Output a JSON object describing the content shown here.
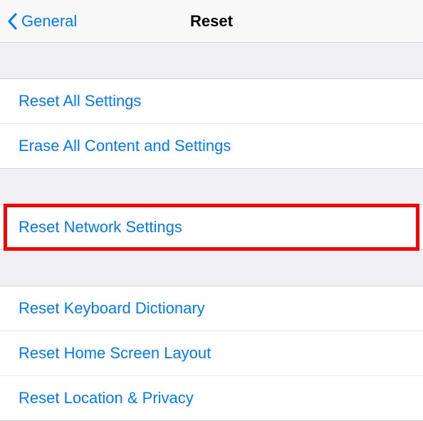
{
  "nav": {
    "back_label": "General",
    "title": "Reset"
  },
  "groups": [
    {
      "items": [
        {
          "label": "Reset All Settings",
          "name": "reset-all-settings"
        },
        {
          "label": "Erase All Content and Settings",
          "name": "erase-all-content"
        }
      ]
    },
    {
      "items": [
        {
          "label": "Reset Network Settings",
          "name": "reset-network-settings",
          "highlighted": true
        }
      ]
    },
    {
      "items": [
        {
          "label": "Reset Keyboard Dictionary",
          "name": "reset-keyboard-dictionary"
        },
        {
          "label": "Reset Home Screen Layout",
          "name": "reset-home-screen-layout"
        },
        {
          "label": "Reset Location & Privacy",
          "name": "reset-location-privacy"
        }
      ]
    }
  ]
}
